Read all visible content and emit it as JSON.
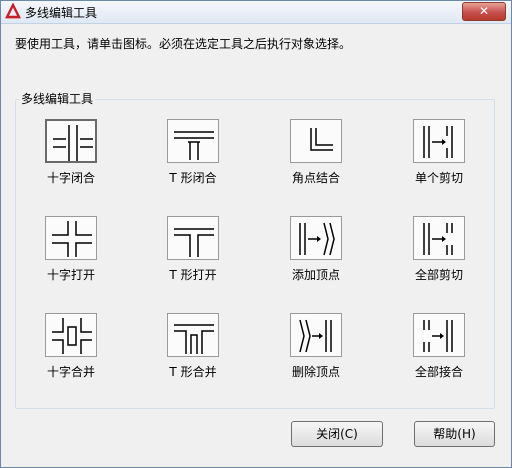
{
  "window": {
    "title": "多线编辑工具",
    "close_symbol": "✕"
  },
  "instruction": "要使用工具，请单击图标。必须在选定工具之后执行对象选择。",
  "group_label": "多线编辑工具",
  "tools": [
    {
      "label": "十字闭合",
      "icon": "cross-closed-icon",
      "selected": true
    },
    {
      "label": "T 形闭合",
      "icon": "tee-closed-icon"
    },
    {
      "label": "角点结合",
      "icon": "corner-joint-icon"
    },
    {
      "label": "单个剪切",
      "icon": "cut-single-icon"
    },
    {
      "label": "十字打开",
      "icon": "cross-open-icon"
    },
    {
      "label": "T 形打开",
      "icon": "tee-open-icon"
    },
    {
      "label": "添加顶点",
      "icon": "add-vertex-icon"
    },
    {
      "label": "全部剪切",
      "icon": "cut-all-icon"
    },
    {
      "label": "十字合并",
      "icon": "cross-merged-icon"
    },
    {
      "label": "T 形合并",
      "icon": "tee-merged-icon"
    },
    {
      "label": "删除顶点",
      "icon": "delete-vertex-icon"
    },
    {
      "label": "全部接合",
      "icon": "weld-all-icon"
    }
  ],
  "buttons": {
    "close": "关闭(C)",
    "help": "帮助(H)"
  }
}
